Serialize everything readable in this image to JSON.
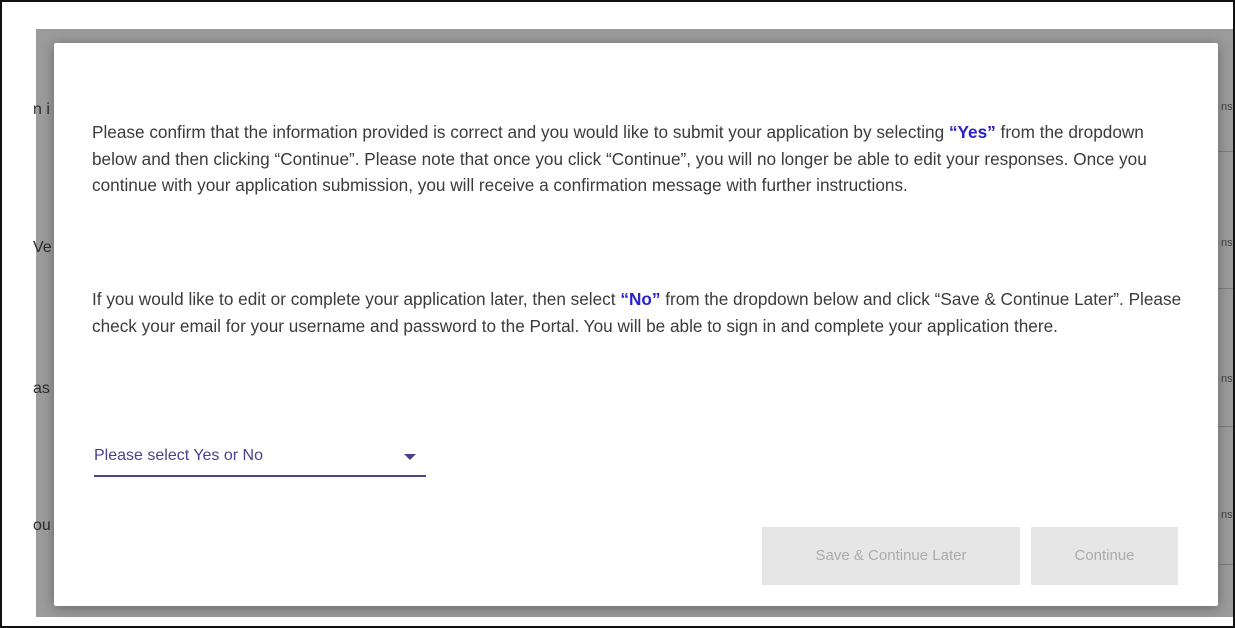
{
  "dialog": {
    "paragraph1": {
      "before": "Please confirm that the information provided is correct and you would like to submit your application by selecting ",
      "highlight": "“Yes”",
      "after": " from the dropdown below and then clicking “Continue”. Please note that once you click “Continue”, you will no longer be able to edit your responses. Once you continue with your application submission, you will receive a confirmation message with further instructions."
    },
    "paragraph2": {
      "before": "If you would like to edit or complete your application later, then select ",
      "highlight": "“No”",
      "after": " from the dropdown below and click “Save & Continue Later”. Please check your email for your username and password to the Portal. You will be able to sign in and complete your application there."
    },
    "select": {
      "value": "Please select Yes or No"
    },
    "buttons": {
      "save_label": "Save & Continue Later",
      "continue_label": "Continue"
    }
  },
  "background": {
    "left_fragments": [
      "n i",
      "Ve",
      "as",
      "ou"
    ],
    "right_fragments": [
      "ns",
      "ns",
      "ns",
      "ns"
    ]
  },
  "colors": {
    "highlight": "#2723c9",
    "select_accent": "#4e3f8f",
    "button_disabled_bg": "#e6e6e6",
    "button_disabled_text": "#ababab",
    "backdrop": "#9b9b9b"
  },
  "icons": {
    "select_caret": "caret-down-icon"
  }
}
